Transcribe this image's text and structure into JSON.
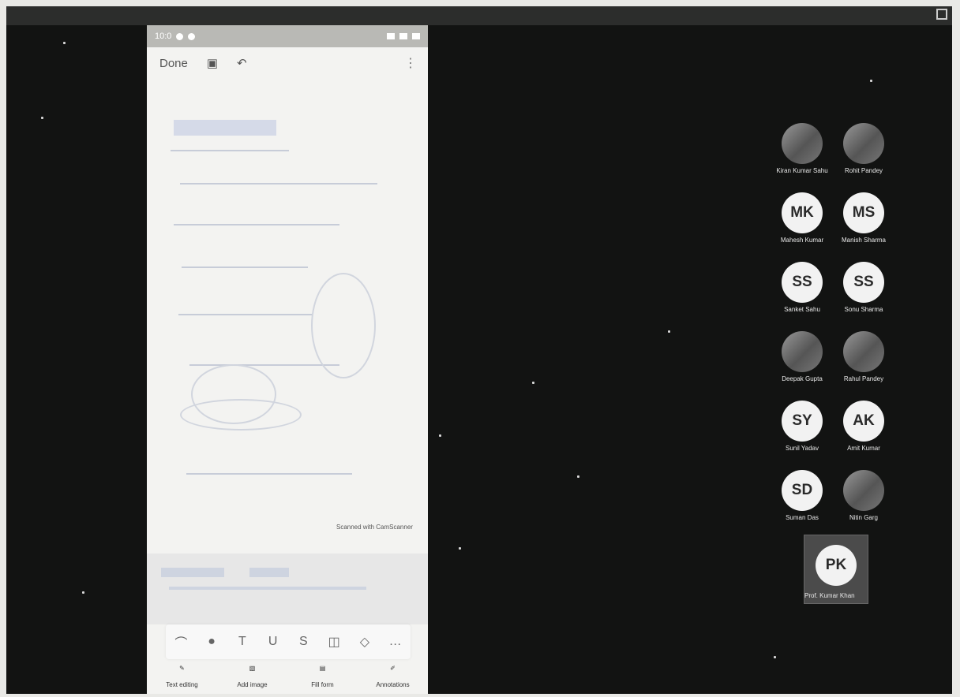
{
  "phone": {
    "top_bar": {
      "done_label": "Done",
      "status_time": "10:0",
      "save_icon": "save-icon",
      "undo_icon": "undo-icon",
      "more_icon": "more-icon"
    },
    "document_note": "Scanned with CamScanner",
    "drawing_tools": [
      {
        "name": "lasso-tool-icon",
        "glyph": "⌒"
      },
      {
        "name": "pen-tool-icon",
        "glyph": "●"
      },
      {
        "name": "text-tool-icon",
        "glyph": "T"
      },
      {
        "name": "underline-tool-icon",
        "glyph": "U"
      },
      {
        "name": "strikethrough-tool-icon",
        "glyph": "S"
      },
      {
        "name": "shape-tool-icon",
        "glyph": "◫"
      },
      {
        "name": "eraser-tool-icon",
        "glyph": "◇"
      },
      {
        "name": "more-tools-icon",
        "glyph": "…"
      }
    ],
    "bottom_actions": [
      {
        "label": "Text editing",
        "icon": "text-edit-icon"
      },
      {
        "label": "Add image",
        "icon": "image-icon"
      },
      {
        "label": "Fill form",
        "icon": "form-icon"
      },
      {
        "label": "Annotations",
        "icon": "pen-icon"
      }
    ]
  },
  "participants": [
    {
      "initials": "",
      "name": "Kiran Kumar Sahu",
      "photo": true
    },
    {
      "initials": "",
      "name": "Rohit Pandey",
      "photo": true
    },
    {
      "initials": "MK",
      "name": "Mahesh Kumar",
      "photo": false
    },
    {
      "initials": "MS",
      "name": "Manish Sharma",
      "photo": false
    },
    {
      "initials": "SS",
      "name": "Sanket Sahu",
      "photo": false
    },
    {
      "initials": "SS",
      "name": "Sonu Sharma",
      "photo": false
    },
    {
      "initials": "",
      "name": "Deepak Gupta",
      "photo": true
    },
    {
      "initials": "",
      "name": "Rahul Pandey",
      "photo": true
    },
    {
      "initials": "SY",
      "name": "Sunil Yadav",
      "photo": false
    },
    {
      "initials": "AK",
      "name": "Amit Kumar",
      "photo": false
    },
    {
      "initials": "SD",
      "name": "Suman Das",
      "photo": false
    },
    {
      "initials": "",
      "name": "Nitin Garg",
      "photo": true
    }
  ],
  "presenter": {
    "initials": "PK",
    "name": "Prof. Kumar Khan"
  }
}
